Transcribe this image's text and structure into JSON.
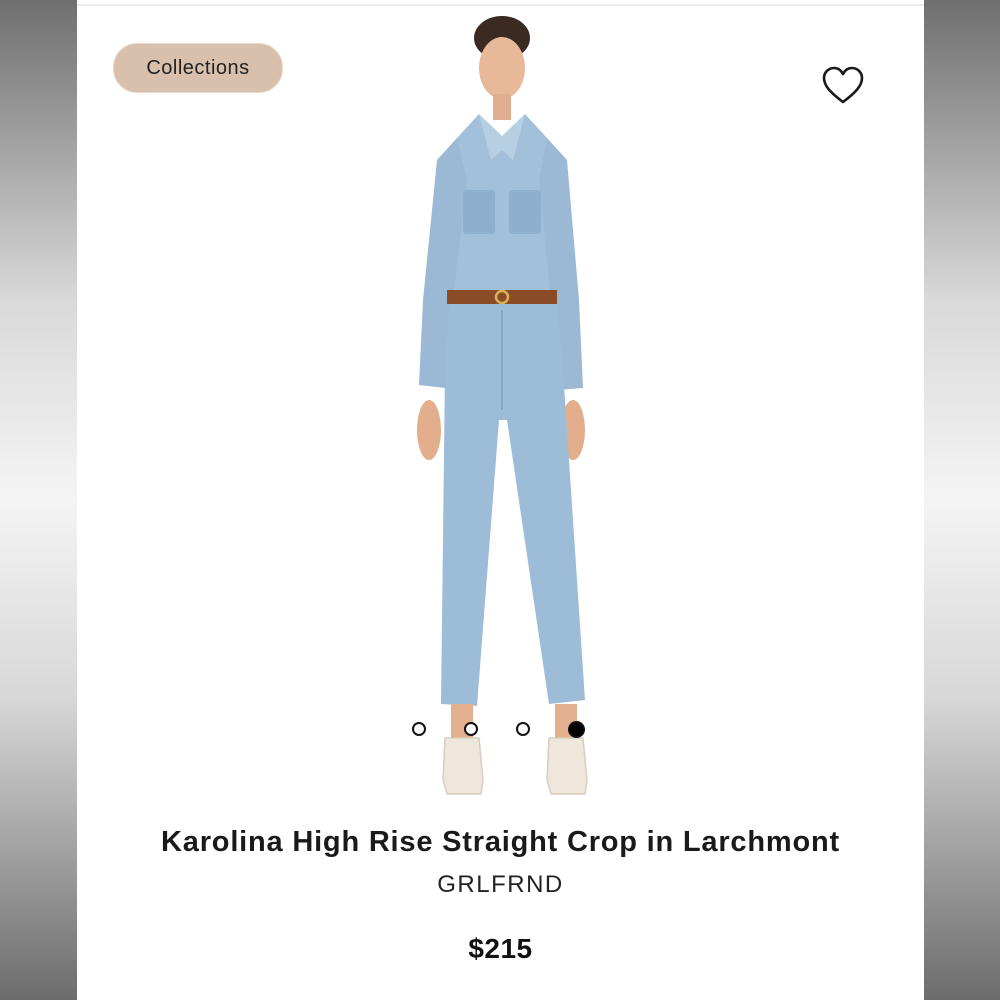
{
  "chip": {
    "label": "Collections"
  },
  "favorite": {
    "icon": "heart-outline-icon"
  },
  "carousel": {
    "total": 4,
    "active_index": 3
  },
  "product": {
    "title": "Karolina High Rise Straight Crop in Larchmont",
    "brand": "GRLFRND",
    "price": "$215"
  },
  "colors": {
    "chip_bg": "#d9c0ad",
    "denim": "#9dbcd8"
  }
}
